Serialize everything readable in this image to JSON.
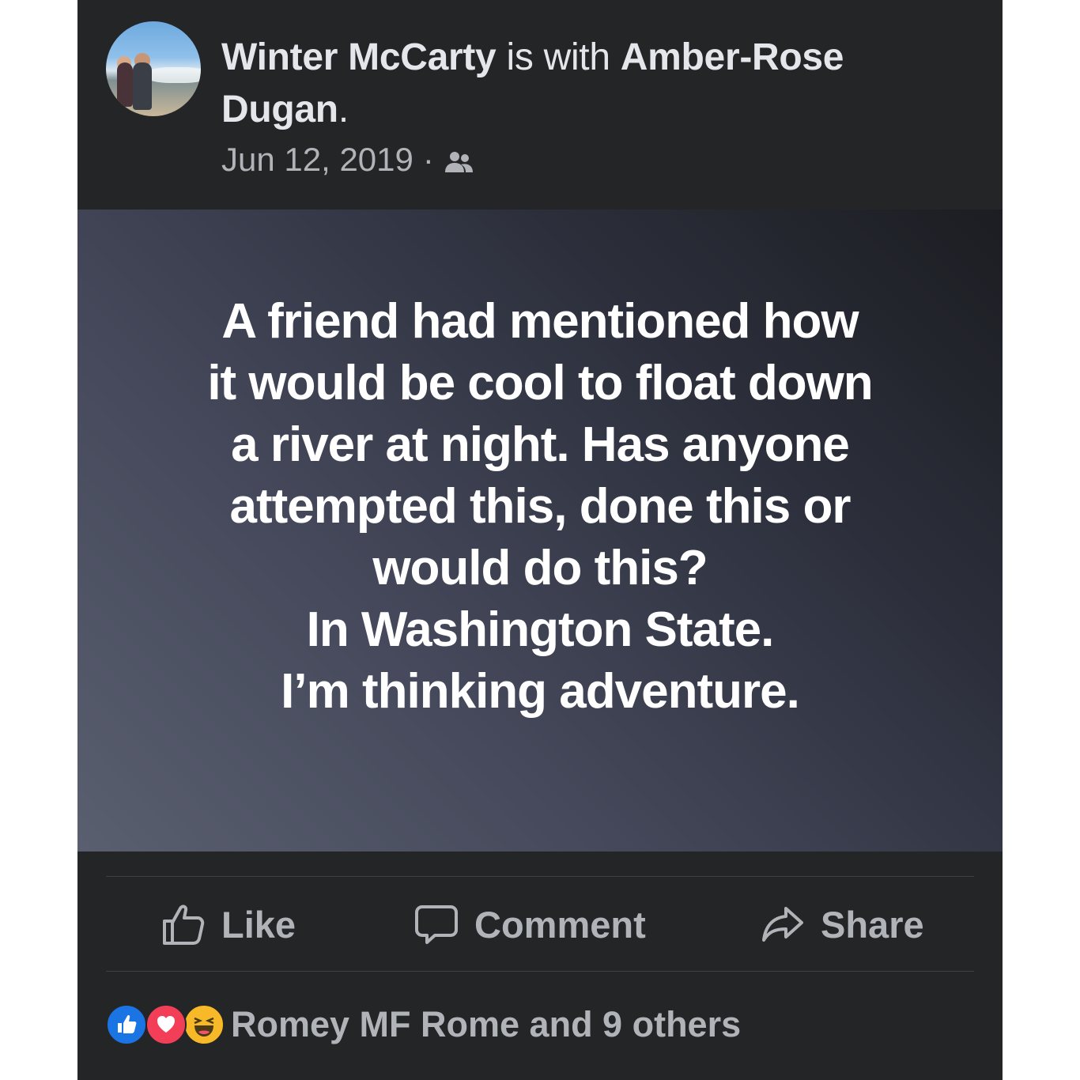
{
  "post": {
    "author": "Winter McCarty",
    "with_text": " is with ",
    "tagged": "Amber-Rose Dugan",
    "title_end": ".",
    "date": "Jun 12, 2019",
    "separator": "·",
    "audience_icon": "friends-icon"
  },
  "status": {
    "lines": [
      "A friend had mentioned how",
      "it would be cool to float down",
      "a river at night. Has anyone",
      "attempted this, done this or",
      "would do this?",
      "In Washington State.",
      "I’m thinking adventure."
    ],
    "gradient_colors": [
      "#5a5f70",
      "#44485a",
      "#2c2f3b",
      "#1c1d22"
    ]
  },
  "actions": {
    "like_label": "Like",
    "comment_label": "Comment",
    "share_label": "Share"
  },
  "reactions": {
    "icons": [
      "like-reaction-icon",
      "love-reaction-icon",
      "haha-reaction-icon"
    ],
    "summary": "Romey MF Rome and 9 others"
  },
  "colors": {
    "card_bg": "#242526",
    "primary_text": "#e4e6eb",
    "secondary_text": "#b0b3b8",
    "like_blue": "#1b74e4",
    "love_red": "#f33e58",
    "haha_yellow": "#f7b928"
  }
}
